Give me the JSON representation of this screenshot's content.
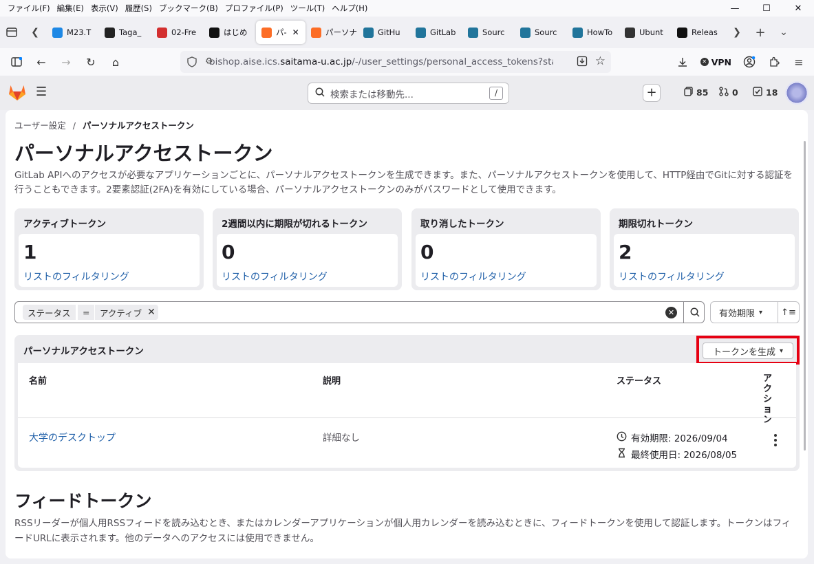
{
  "browser": {
    "menu": [
      "ファイル(F)",
      "編集(E)",
      "表示(V)",
      "履歴(S)",
      "ブックマーク(B)",
      "プロファイル(P)",
      "ツール(T)",
      "ヘルプ(H)"
    ],
    "tabs": [
      {
        "label": "M23.T",
        "icon": "cloud-icon",
        "color": "#1e88e5"
      },
      {
        "label": "Taga_",
        "icon": "pdf-icon",
        "color": "#222222"
      },
      {
        "label": "02-Fre",
        "icon": "flower-icon",
        "color": "#d32f2f"
      },
      {
        "label": "はじめ",
        "icon": "r-icon",
        "color": "#111111"
      },
      {
        "label": "パ-",
        "icon": "gitlab-icon",
        "color": "#fc6d26",
        "active": true
      },
      {
        "label": "パーソナ",
        "icon": "gitlab-icon",
        "color": "#fc6d26"
      },
      {
        "label": "GitHu",
        "icon": "wordpress-icon",
        "color": "#21759b"
      },
      {
        "label": "GitLab",
        "icon": "wordpress-icon",
        "color": "#21759b"
      },
      {
        "label": "Sourc",
        "icon": "wordpress-icon",
        "color": "#21759b"
      },
      {
        "label": "Sourc",
        "icon": "wordpress-icon",
        "color": "#21759b"
      },
      {
        "label": "HowTo",
        "icon": "wordpress-icon",
        "color": "#21759b"
      },
      {
        "label": "Ubunt",
        "icon": "ubuntu-icon",
        "color": "#333333"
      },
      {
        "label": "Releas",
        "icon": "github-icon",
        "color": "#111111"
      }
    ],
    "url_prefix": "bishop.aise.ics.",
    "url_domain": "saitama-u.ac.jp",
    "url_suffix": "/-/user_settings/personal_access_tokens?state=active",
    "vpn_label": "VPN"
  },
  "gitlab_header": {
    "search_placeholder": "検索または移動先...",
    "search_shortcut": "/",
    "issues_count": "85",
    "mr_count": "0",
    "todo_count": "18"
  },
  "breadcrumb": {
    "parent": "ユーザー設定",
    "separator": "/",
    "current": "パーソナルアクセストークン"
  },
  "page": {
    "title": "パーソナルアクセストークン",
    "description": "GitLab APIへのアクセスが必要なアプリケーションごとに、パーソナルアクセストークンを生成できます。また、パーソナルアクセストークンを使用して、HTTP経由でGitに対する認証を行うこともできます。2要素認証(2FA)を有効にしている場合、パーソナルアクセストークンのみがパスワードとして使用できます。"
  },
  "stats": [
    {
      "title": "アクティブトークン",
      "value": "1",
      "link": "リストのフィルタリング"
    },
    {
      "title": "2週間以内に期限が切れるトークン",
      "value": "0",
      "link": "リストのフィルタリング"
    },
    {
      "title": "取り消したトークン",
      "value": "0",
      "link": "リストのフィルタリング"
    },
    {
      "title": "期限切れトークン",
      "value": "2",
      "link": "リストのフィルタリング"
    }
  ],
  "filter": {
    "key": "ステータス",
    "operator": "=",
    "value": "アクティブ",
    "sort_label": "有効期限"
  },
  "tokens": {
    "title": "パーソナルアクセストークン",
    "generate_label": "トークンを生成",
    "columns": {
      "name": "名前",
      "description": "説明",
      "status": "ステータス",
      "actions": "アクション"
    },
    "rows": [
      {
        "name": "大学のデスクトップ",
        "description": "詳細なし",
        "expires": "有効期限: 2026/09/04",
        "last_used": "最終使用日: 2026/08/05"
      }
    ]
  },
  "feed": {
    "title": "フィードトークン",
    "description": "RSSリーダーが個人用RSSフィードを読み込むとき、またはカレンダーアプリケーションが個人用カレンダーを読み込むときに、フィードトークンを使用して認証します。トークンはフィードURLに表示されます。他のデータへのアクセスには使用できません。"
  },
  "colors": {
    "link": "#1f5fa8",
    "highlight": "#e60012",
    "gitlab_orange": "#fc6d26"
  }
}
